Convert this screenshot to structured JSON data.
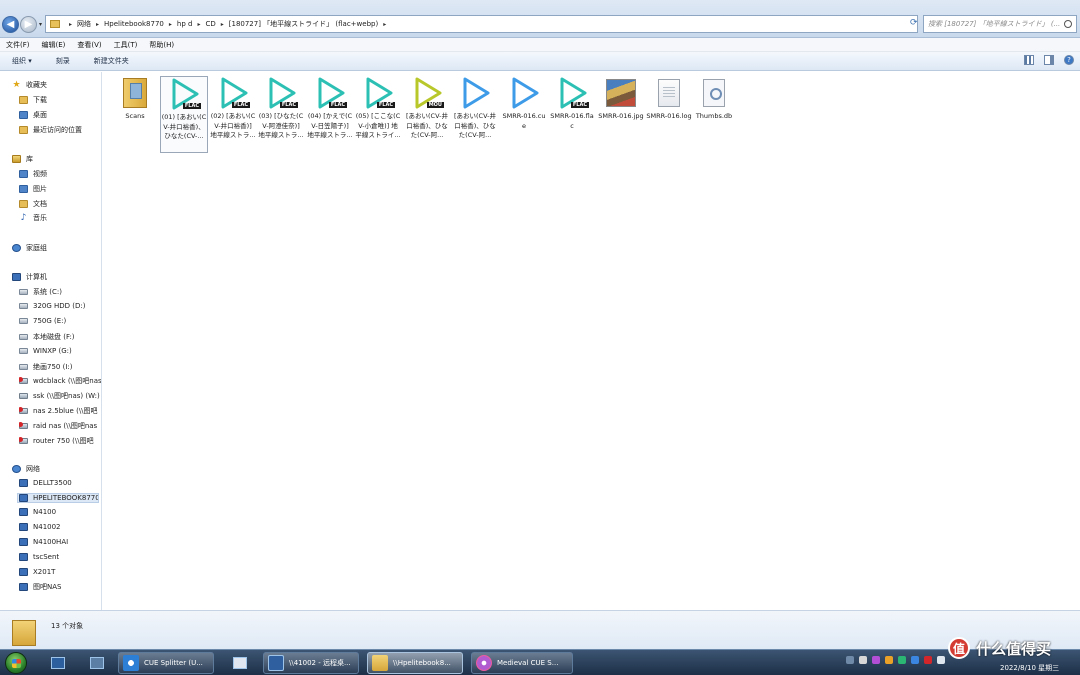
{
  "window": {
    "breadcrumbs": [
      "网络",
      "Hpelitebook8770",
      "hp d",
      "CD",
      "[180727] 「地平線ストライド」 (flac+webp)"
    ],
    "search_placeholder": "搜索 [180727] 「地平線ストライド」 (..."
  },
  "menu": [
    "文件(F)",
    "编辑(E)",
    "查看(V)",
    "工具(T)",
    "帮助(H)"
  ],
  "toolbar": {
    "organize": "组织 ▾",
    "burn": "刻录",
    "new_folder": "新建文件夹"
  },
  "sidebar": {
    "favorites": {
      "label": "收藏夹",
      "items": [
        "下载",
        "桌面",
        "最近访问的位置"
      ]
    },
    "libraries": {
      "label": "库",
      "items": [
        "视频",
        "图片",
        "文档",
        "音乐"
      ]
    },
    "homegroup": {
      "label": "家庭组"
    },
    "computer": {
      "label": "计算机",
      "items": [
        "系统 (C:)",
        "320G HDD (D:)",
        "750G (E:)",
        "本地磁盘 (F:)",
        "WINXP (G:)",
        "绝画750 (I:)",
        "wdcblack (\\\\图吧nas) (",
        "ssk (\\\\图吧nas) (W:)",
        "nas 2.5blue (\\\\图吧",
        "raid nas (\\\\图吧nas",
        "router 750 (\\\\图吧"
      ]
    },
    "network": {
      "label": "网络",
      "items": [
        "DELLT3500",
        "HPELITEBOOK8770",
        "N4100",
        "N41002",
        "N4100HAI",
        "tscSent",
        "X201T",
        "图吧NAS"
      ]
    }
  },
  "files": [
    {
      "type": "folder",
      "name": "Scans"
    },
    {
      "type": "flac",
      "name": "(01) [あおい(CV-井口裕香)、ひなた(CV-..."
    },
    {
      "type": "flac",
      "name": "(02) [あおい(CV-井口裕香)] 地平線ストラ..."
    },
    {
      "type": "flac",
      "name": "(03) [ひなた(CV-阿澄佳奈)] 地平線ストラ..."
    },
    {
      "type": "flac",
      "name": "(04) [かえで(CV-日笠陽子)] 地平線ストラ..."
    },
    {
      "type": "flac",
      "name": "(05) [ここな(CV-小倉唯)] 地平線ストライ..."
    },
    {
      "type": "wav",
      "name": "[あおい(CV-井口裕香)、ひなた(CV-阿..."
    },
    {
      "type": "play",
      "name": "[あおい(CV-井口裕香)、ひなた(CV-阿..."
    },
    {
      "type": "play",
      "name": "SMRR-016.cue"
    },
    {
      "type": "flac",
      "name": "SMRR-016.flac"
    },
    {
      "type": "jpg",
      "name": "SMRR-016.jpg"
    },
    {
      "type": "doc",
      "name": "SMRR-016.log"
    },
    {
      "type": "thumbs",
      "name": "Thumbs.db"
    }
  ],
  "details": {
    "count": "13 个对象"
  },
  "taskbar": {
    "tasks": [
      "CUE Splitter (U...",
      "\\\\41002 - 远程桌...",
      "\\\\Hpelitebook8...",
      "Medieval CUE S..."
    ],
    "clock": "2022/8/10 星期三"
  },
  "watermark": {
    "badge": "值",
    "text": "什么值得买"
  },
  "colors": {
    "flac_play": "#2cc0b4",
    "wav_play": "#b8c82a",
    "cue_play": "#3d9be8"
  }
}
